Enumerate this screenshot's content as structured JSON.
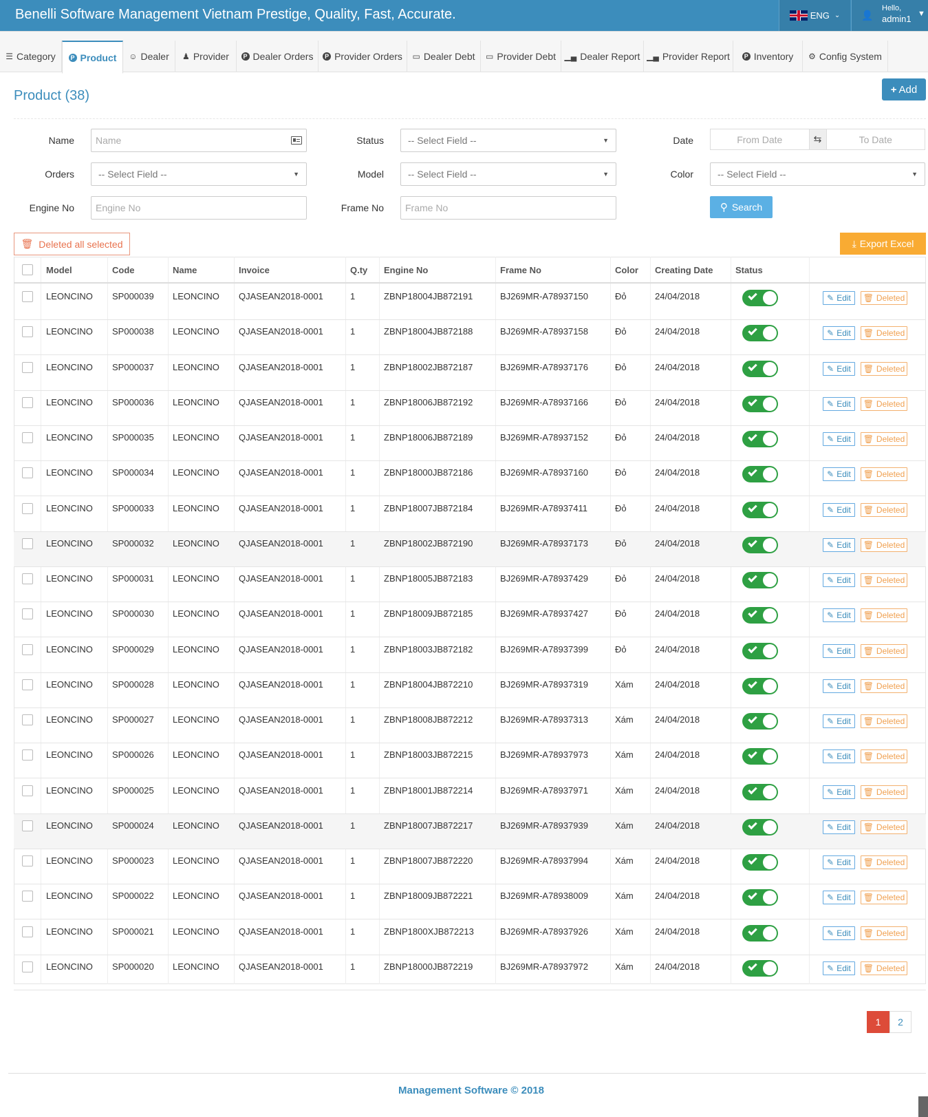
{
  "header": {
    "brand": "Benelli Software Management Vietnam Prestige, Quality, Fast, Accurate.",
    "language": "ENG",
    "hello": "Hello,",
    "username": "admin1"
  },
  "nav": {
    "tabs": [
      {
        "label": "Category",
        "icon": "list-icon",
        "active": false
      },
      {
        "label": "Product",
        "icon": "product-p-icon",
        "active": true
      },
      {
        "label": "Dealer",
        "icon": "user-circle-icon",
        "active": false
      },
      {
        "label": "Provider",
        "icon": "users-icon",
        "active": false
      },
      {
        "label": "Dealer Orders",
        "icon": "product-p-icon",
        "active": false
      },
      {
        "label": "Provider Orders",
        "icon": "product-p-icon",
        "active": false
      },
      {
        "label": "Dealer Debt",
        "icon": "inbox-icon",
        "active": false
      },
      {
        "label": "Provider Debt",
        "icon": "inbox-icon",
        "active": false
      },
      {
        "label": "Dealer Report",
        "icon": "bar-chart-icon",
        "active": false
      },
      {
        "label": "Provider Report",
        "icon": "bar-chart-icon",
        "active": false
      },
      {
        "label": "Inventory",
        "icon": "product-p-icon",
        "active": false
      },
      {
        "label": "Config System",
        "icon": "cogs-icon",
        "active": false
      }
    ]
  },
  "page": {
    "title": "Product (38)",
    "add_label": "Add"
  },
  "filters": {
    "name_label": "Name",
    "name_placeholder": "Name",
    "status_label": "Status",
    "status_value": "-- Select Field --",
    "date_label": "Date",
    "from_date_placeholder": "From Date",
    "to_date_placeholder": "To Date",
    "orders_label": "Orders",
    "orders_value": "-- Select Field --",
    "model_label": "Model",
    "model_value": "-- Select Field --",
    "color_label": "Color",
    "color_value": "-- Select Field --",
    "engine_label": "Engine No",
    "engine_placeholder": "Engine No",
    "frame_label": "Frame No",
    "frame_placeholder": "Frame No",
    "search_label": "Search"
  },
  "actions": {
    "delete_all_label": "Deleted all selected",
    "export_label": "Export Excel",
    "edit_label": "Edit",
    "delete_label": "Deleted"
  },
  "table": {
    "columns": [
      "Model",
      "Code",
      "Name",
      "Invoice",
      "Q.ty",
      "Engine No",
      "Frame No",
      "Color",
      "Creating Date",
      "Status"
    ],
    "rows": [
      [
        "LEONCINO",
        "SP000039",
        "LEONCINO",
        "QJASEAN2018-0001",
        "1",
        "ZBNP18004JB872191",
        "BJ269MR-A78937150",
        "Đỏ",
        "24/04/2018"
      ],
      [
        "LEONCINO",
        "SP000038",
        "LEONCINO",
        "QJASEAN2018-0001",
        "1",
        "ZBNP18004JB872188",
        "BJ269MR-A78937158",
        "Đỏ",
        "24/04/2018"
      ],
      [
        "LEONCINO",
        "SP000037",
        "LEONCINO",
        "QJASEAN2018-0001",
        "1",
        "ZBNP18002JB872187",
        "BJ269MR-A78937176",
        "Đỏ",
        "24/04/2018"
      ],
      [
        "LEONCINO",
        "SP000036",
        "LEONCINO",
        "QJASEAN2018-0001",
        "1",
        "ZBNP18006JB872192",
        "BJ269MR-A78937166",
        "Đỏ",
        "24/04/2018"
      ],
      [
        "LEONCINO",
        "SP000035",
        "LEONCINO",
        "QJASEAN2018-0001",
        "1",
        "ZBNP18006JB872189",
        "BJ269MR-A78937152",
        "Đỏ",
        "24/04/2018"
      ],
      [
        "LEONCINO",
        "SP000034",
        "LEONCINO",
        "QJASEAN2018-0001",
        "1",
        "ZBNP18000JB872186",
        "BJ269MR-A78937160",
        "Đỏ",
        "24/04/2018"
      ],
      [
        "LEONCINO",
        "SP000033",
        "LEONCINO",
        "QJASEAN2018-0001",
        "1",
        "ZBNP18007JB872184",
        "BJ269MR-A78937411",
        "Đỏ",
        "24/04/2018"
      ],
      [
        "LEONCINO",
        "SP000032",
        "LEONCINO",
        "QJASEAN2018-0001",
        "1",
        "ZBNP18002JB872190",
        "BJ269MR-A78937173",
        "Đỏ",
        "24/04/2018"
      ],
      [
        "LEONCINO",
        "SP000031",
        "LEONCINO",
        "QJASEAN2018-0001",
        "1",
        "ZBNP18005JB872183",
        "BJ269MR-A78937429",
        "Đỏ",
        "24/04/2018"
      ],
      [
        "LEONCINO",
        "SP000030",
        "LEONCINO",
        "QJASEAN2018-0001",
        "1",
        "ZBNP18009JB872185",
        "BJ269MR-A78937427",
        "Đỏ",
        "24/04/2018"
      ],
      [
        "LEONCINO",
        "SP000029",
        "LEONCINO",
        "QJASEAN2018-0001",
        "1",
        "ZBNP18003JB872182",
        "BJ269MR-A78937399",
        "Đỏ",
        "24/04/2018"
      ],
      [
        "LEONCINO",
        "SP000028",
        "LEONCINO",
        "QJASEAN2018-0001",
        "1",
        "ZBNP18004JB872210",
        "BJ269MR-A78937319",
        "Xám",
        "24/04/2018"
      ],
      [
        "LEONCINO",
        "SP000027",
        "LEONCINO",
        "QJASEAN2018-0001",
        "1",
        "ZBNP18008JB872212",
        "BJ269MR-A78937313",
        "Xám",
        "24/04/2018"
      ],
      [
        "LEONCINO",
        "SP000026",
        "LEONCINO",
        "QJASEAN2018-0001",
        "1",
        "ZBNP18003JB872215",
        "BJ269MR-A78937973",
        "Xám",
        "24/04/2018"
      ],
      [
        "LEONCINO",
        "SP000025",
        "LEONCINO",
        "QJASEAN2018-0001",
        "1",
        "ZBNP18001JB872214",
        "BJ269MR-A78937971",
        "Xám",
        "24/04/2018"
      ],
      [
        "LEONCINO",
        "SP000024",
        "LEONCINO",
        "QJASEAN2018-0001",
        "1",
        "ZBNP18007JB872217",
        "BJ269MR-A78937939",
        "Xám",
        "24/04/2018"
      ],
      [
        "LEONCINO",
        "SP000023",
        "LEONCINO",
        "QJASEAN2018-0001",
        "1",
        "ZBNP18007JB872220",
        "BJ269MR-A78937994",
        "Xám",
        "24/04/2018"
      ],
      [
        "LEONCINO",
        "SP000022",
        "LEONCINO",
        "QJASEAN2018-0001",
        "1",
        "ZBNP18009JB872221",
        "BJ269MR-A78938009",
        "Xám",
        "24/04/2018"
      ],
      [
        "LEONCINO",
        "SP000021",
        "LEONCINO",
        "QJASEAN2018-0001",
        "1",
        "ZBNP1800XJB872213",
        "BJ269MR-A78937926",
        "Xám",
        "24/04/2018"
      ],
      [
        "LEONCINO",
        "SP000020",
        "LEONCINO",
        "QJASEAN2018-0001",
        "1",
        "ZBNP18000JB872219",
        "BJ269MR-A78937972",
        "Xám",
        "24/04/2018"
      ]
    ]
  },
  "pagination": {
    "pages": [
      "1",
      "2"
    ],
    "current": "1"
  },
  "footer": {
    "text": "Management Software © 2018"
  },
  "colors": {
    "primary": "#3c8dbc",
    "toggle_on": "#2ea043",
    "danger": "#dd4b39",
    "warning": "#f9ab33"
  }
}
